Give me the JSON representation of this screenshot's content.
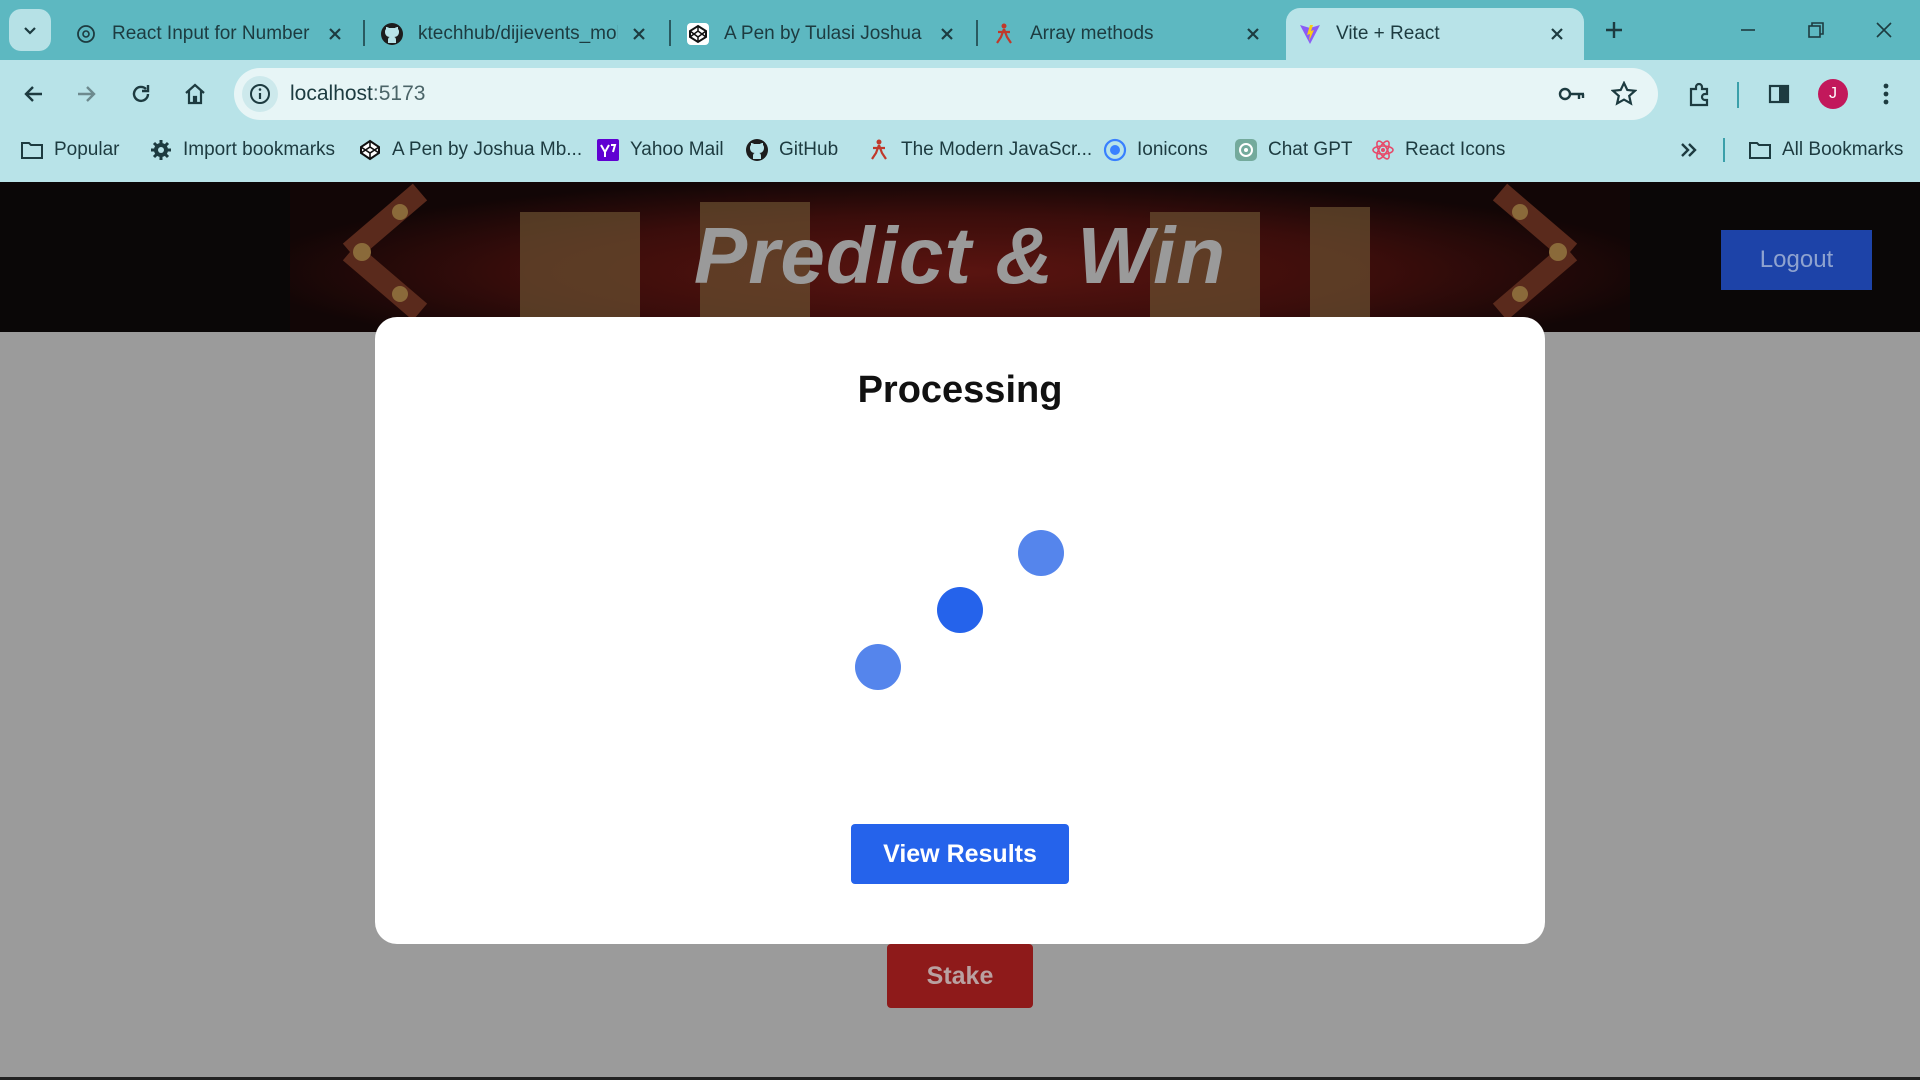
{
  "browser": {
    "tabs": [
      {
        "title": "React Input for Number",
        "icon": "chatgpt-icon",
        "active": false
      },
      {
        "title": "ktechhub/dijievents_mob",
        "icon": "github-icon",
        "active": false
      },
      {
        "title": "A Pen by Tulasi Joshua M",
        "icon": "codepen-icon",
        "active": false
      },
      {
        "title": "Array methods",
        "icon": "javascript-info-icon",
        "active": false
      },
      {
        "title": "Vite + React",
        "icon": "vite-icon",
        "active": true
      }
    ],
    "url_host": "localhost",
    "url_port": ":5173",
    "profile_initial": "J",
    "bookmarks": [
      {
        "label": "Popular",
        "icon": "folder-icon"
      },
      {
        "label": "Import bookmarks",
        "icon": "gear-icon"
      },
      {
        "label": "A Pen by Joshua Mb...",
        "icon": "codepen-icon"
      },
      {
        "label": "Yahoo Mail",
        "icon": "yahoo-icon"
      },
      {
        "label": "GitHub",
        "icon": "github-icon"
      },
      {
        "label": "The Modern JavaScr...",
        "icon": "javascript-info-icon"
      },
      {
        "label": "Ionicons",
        "icon": "ionicons-icon"
      },
      {
        "label": "Chat GPT",
        "icon": "chatgpt-icon"
      },
      {
        "label": "React Icons",
        "icon": "react-icon"
      }
    ],
    "all_bookmarks": "All Bookmarks"
  },
  "page": {
    "hero_title": "Predict & Win",
    "logout_label": "Logout",
    "stake_label": "Stake"
  },
  "modal": {
    "title": "Processing",
    "view_results_label": "View Results"
  },
  "colors": {
    "tabstrip": "#5db8c1",
    "toolbar": "#b8e3e8",
    "primary_button": "#2563eb",
    "logout_button": "#1d43a8",
    "stake_button": "#8e1a1a",
    "spinner_dot": "#2563eb",
    "spinner_dot_faded": "#5585ec",
    "profile_avatar": "#c2185b"
  }
}
